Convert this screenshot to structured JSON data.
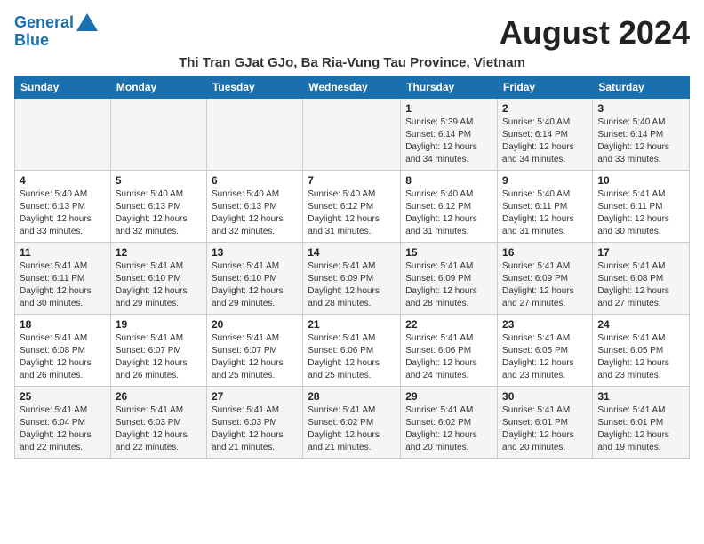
{
  "logo": {
    "line1": "General",
    "line2": "Blue"
  },
  "title": {
    "month_year": "August 2024",
    "location": "Thi Tran GJat GJo, Ba Ria-Vung Tau Province, Vietnam"
  },
  "days_of_week": [
    "Sunday",
    "Monday",
    "Tuesday",
    "Wednesday",
    "Thursday",
    "Friday",
    "Saturday"
  ],
  "weeks": [
    [
      {
        "day": "",
        "info": ""
      },
      {
        "day": "",
        "info": ""
      },
      {
        "day": "",
        "info": ""
      },
      {
        "day": "",
        "info": ""
      },
      {
        "day": "1",
        "info": "Sunrise: 5:39 AM\nSunset: 6:14 PM\nDaylight: 12 hours\nand 34 minutes."
      },
      {
        "day": "2",
        "info": "Sunrise: 5:40 AM\nSunset: 6:14 PM\nDaylight: 12 hours\nand 34 minutes."
      },
      {
        "day": "3",
        "info": "Sunrise: 5:40 AM\nSunset: 6:14 PM\nDaylight: 12 hours\nand 33 minutes."
      }
    ],
    [
      {
        "day": "4",
        "info": "Sunrise: 5:40 AM\nSunset: 6:13 PM\nDaylight: 12 hours\nand 33 minutes."
      },
      {
        "day": "5",
        "info": "Sunrise: 5:40 AM\nSunset: 6:13 PM\nDaylight: 12 hours\nand 32 minutes."
      },
      {
        "day": "6",
        "info": "Sunrise: 5:40 AM\nSunset: 6:13 PM\nDaylight: 12 hours\nand 32 minutes."
      },
      {
        "day": "7",
        "info": "Sunrise: 5:40 AM\nSunset: 6:12 PM\nDaylight: 12 hours\nand 31 minutes."
      },
      {
        "day": "8",
        "info": "Sunrise: 5:40 AM\nSunset: 6:12 PM\nDaylight: 12 hours\nand 31 minutes."
      },
      {
        "day": "9",
        "info": "Sunrise: 5:40 AM\nSunset: 6:11 PM\nDaylight: 12 hours\nand 31 minutes."
      },
      {
        "day": "10",
        "info": "Sunrise: 5:41 AM\nSunset: 6:11 PM\nDaylight: 12 hours\nand 30 minutes."
      }
    ],
    [
      {
        "day": "11",
        "info": "Sunrise: 5:41 AM\nSunset: 6:11 PM\nDaylight: 12 hours\nand 30 minutes."
      },
      {
        "day": "12",
        "info": "Sunrise: 5:41 AM\nSunset: 6:10 PM\nDaylight: 12 hours\nand 29 minutes."
      },
      {
        "day": "13",
        "info": "Sunrise: 5:41 AM\nSunset: 6:10 PM\nDaylight: 12 hours\nand 29 minutes."
      },
      {
        "day": "14",
        "info": "Sunrise: 5:41 AM\nSunset: 6:09 PM\nDaylight: 12 hours\nand 28 minutes."
      },
      {
        "day": "15",
        "info": "Sunrise: 5:41 AM\nSunset: 6:09 PM\nDaylight: 12 hours\nand 28 minutes."
      },
      {
        "day": "16",
        "info": "Sunrise: 5:41 AM\nSunset: 6:09 PM\nDaylight: 12 hours\nand 27 minutes."
      },
      {
        "day": "17",
        "info": "Sunrise: 5:41 AM\nSunset: 6:08 PM\nDaylight: 12 hours\nand 27 minutes."
      }
    ],
    [
      {
        "day": "18",
        "info": "Sunrise: 5:41 AM\nSunset: 6:08 PM\nDaylight: 12 hours\nand 26 minutes."
      },
      {
        "day": "19",
        "info": "Sunrise: 5:41 AM\nSunset: 6:07 PM\nDaylight: 12 hours\nand 26 minutes."
      },
      {
        "day": "20",
        "info": "Sunrise: 5:41 AM\nSunset: 6:07 PM\nDaylight: 12 hours\nand 25 minutes."
      },
      {
        "day": "21",
        "info": "Sunrise: 5:41 AM\nSunset: 6:06 PM\nDaylight: 12 hours\nand 25 minutes."
      },
      {
        "day": "22",
        "info": "Sunrise: 5:41 AM\nSunset: 6:06 PM\nDaylight: 12 hours\nand 24 minutes."
      },
      {
        "day": "23",
        "info": "Sunrise: 5:41 AM\nSunset: 6:05 PM\nDaylight: 12 hours\nand 23 minutes."
      },
      {
        "day": "24",
        "info": "Sunrise: 5:41 AM\nSunset: 6:05 PM\nDaylight: 12 hours\nand 23 minutes."
      }
    ],
    [
      {
        "day": "25",
        "info": "Sunrise: 5:41 AM\nSunset: 6:04 PM\nDaylight: 12 hours\nand 22 minutes."
      },
      {
        "day": "26",
        "info": "Sunrise: 5:41 AM\nSunset: 6:03 PM\nDaylight: 12 hours\nand 22 minutes."
      },
      {
        "day": "27",
        "info": "Sunrise: 5:41 AM\nSunset: 6:03 PM\nDaylight: 12 hours\nand 21 minutes."
      },
      {
        "day": "28",
        "info": "Sunrise: 5:41 AM\nSunset: 6:02 PM\nDaylight: 12 hours\nand 21 minutes."
      },
      {
        "day": "29",
        "info": "Sunrise: 5:41 AM\nSunset: 6:02 PM\nDaylight: 12 hours\nand 20 minutes."
      },
      {
        "day": "30",
        "info": "Sunrise: 5:41 AM\nSunset: 6:01 PM\nDaylight: 12 hours\nand 20 minutes."
      },
      {
        "day": "31",
        "info": "Sunrise: 5:41 AM\nSunset: 6:01 PM\nDaylight: 12 hours\nand 19 minutes."
      }
    ]
  ]
}
